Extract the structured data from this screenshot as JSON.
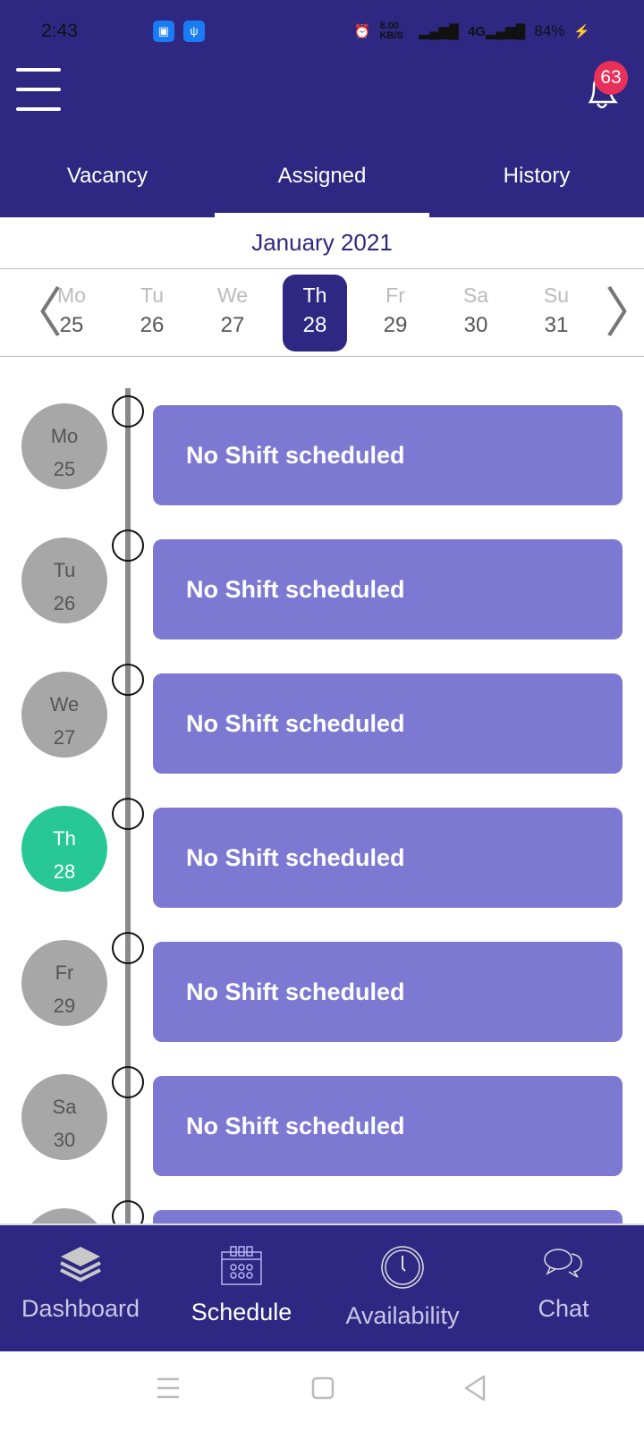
{
  "status_bar": {
    "time": "2:43",
    "speed": "8.00 KB/S",
    "battery": "84%"
  },
  "header": {
    "notification_count": "63"
  },
  "tabs": [
    {
      "label": "Vacancy"
    },
    {
      "label": "Assigned",
      "active": true
    },
    {
      "label": "History"
    }
  ],
  "month": "January 2021",
  "week": [
    {
      "d": "Mo",
      "n": "25"
    },
    {
      "d": "Tu",
      "n": "26"
    },
    {
      "d": "We",
      "n": "27"
    },
    {
      "d": "Th",
      "n": "28",
      "selected": true
    },
    {
      "d": "Fr",
      "n": "29"
    },
    {
      "d": "Sa",
      "n": "30"
    },
    {
      "d": "Su",
      "n": "31"
    }
  ],
  "schedule": [
    {
      "d": "Mo",
      "n": "25",
      "text": "No Shift scheduled"
    },
    {
      "d": "Tu",
      "n": "26",
      "text": "No Shift scheduled"
    },
    {
      "d": "We",
      "n": "27",
      "text": "No Shift scheduled"
    },
    {
      "d": "Th",
      "n": "28",
      "text": "No Shift scheduled",
      "today": true
    },
    {
      "d": "Fr",
      "n": "29",
      "text": "No Shift scheduled"
    },
    {
      "d": "Sa",
      "n": "30",
      "text": "No Shift scheduled"
    },
    {
      "d": "",
      "n": "",
      "text": ""
    }
  ],
  "bottom_nav": [
    {
      "label": "Dashboard",
      "icon": "layers-icon"
    },
    {
      "label": "Schedule",
      "icon": "calendar-icon",
      "active": true
    },
    {
      "label": "Availability",
      "icon": "clock-icon"
    },
    {
      "label": "Chat",
      "icon": "chat-icon"
    }
  ],
  "colors": {
    "primary": "#2f2883",
    "card": "#7d78d2",
    "today": "#27c796",
    "badge": "#e8305a"
  }
}
